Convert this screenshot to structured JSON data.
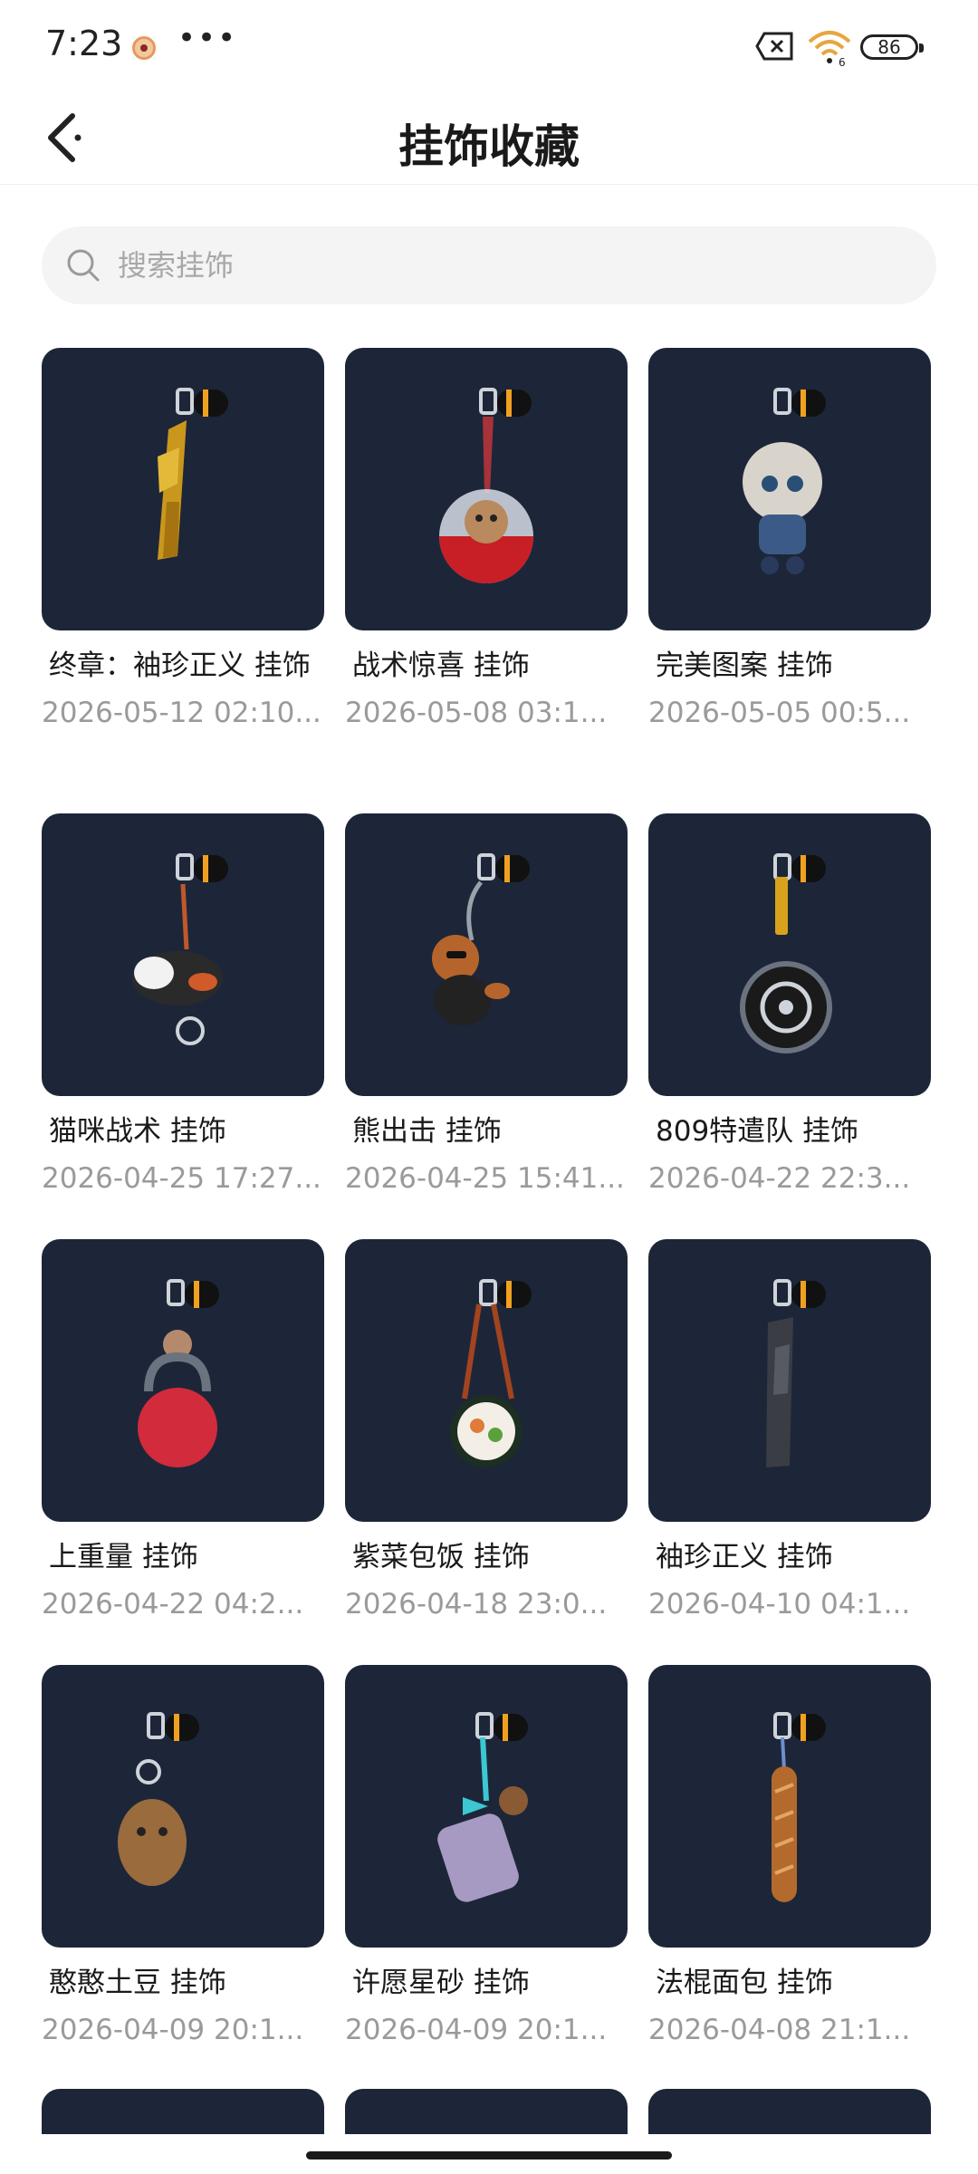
{
  "status_bar": {
    "time": "7:23",
    "battery": "86",
    "signal_label": "6"
  },
  "header": {
    "title": "挂饰收藏"
  },
  "search": {
    "placeholder": "搜索挂饰"
  },
  "items": [
    {
      "title": "终章：袖珍正义 挂饰",
      "date": "2026-05-12 02:10...",
      "icon": "golden-pistol-charm-icon"
    },
    {
      "title": "战术惊喜 挂饰",
      "date": "2026-05-08 03:1...",
      "icon": "capsule-bear-charm-icon"
    },
    {
      "title": "完美图案 挂饰",
      "date": "2026-05-05 00:5...",
      "icon": "doll-charm-icon"
    },
    {
      "title": "猫咪战术 挂饰",
      "date": "2026-04-25 17:27...",
      "icon": "cat-charm-icon"
    },
    {
      "title": "熊出击 挂饰",
      "date": "2026-04-25 15:41...",
      "icon": "bear-charm-icon"
    },
    {
      "title": "809特遣队 挂饰",
      "date": "2026-04-22 22:3...",
      "icon": "ring-charm-icon"
    },
    {
      "title": "上重量 挂饰",
      "date": "2026-04-22 04:2...",
      "icon": "kettlebell-charm-icon"
    },
    {
      "title": "紫菜包饭 挂饰",
      "date": "2026-04-18 23:0...",
      "icon": "sushi-charm-icon"
    },
    {
      "title": "袖珍正义 挂饰",
      "date": "2026-04-10 04:1...",
      "icon": "pistol-charm-icon"
    },
    {
      "title": "憨憨土豆 挂饰",
      "date": "2026-04-09 20:1...",
      "icon": "potato-charm-icon"
    },
    {
      "title": "许愿星砂 挂饰",
      "date": "2026-04-09 20:1...",
      "icon": "wish-jar-charm-icon"
    },
    {
      "title": "法棍面包 挂饰",
      "date": "2026-04-08 21:1...",
      "icon": "baguette-charm-icon"
    }
  ],
  "colors": {
    "thumb_bg": "#1d2638",
    "accent_ring": "#f0a020"
  }
}
